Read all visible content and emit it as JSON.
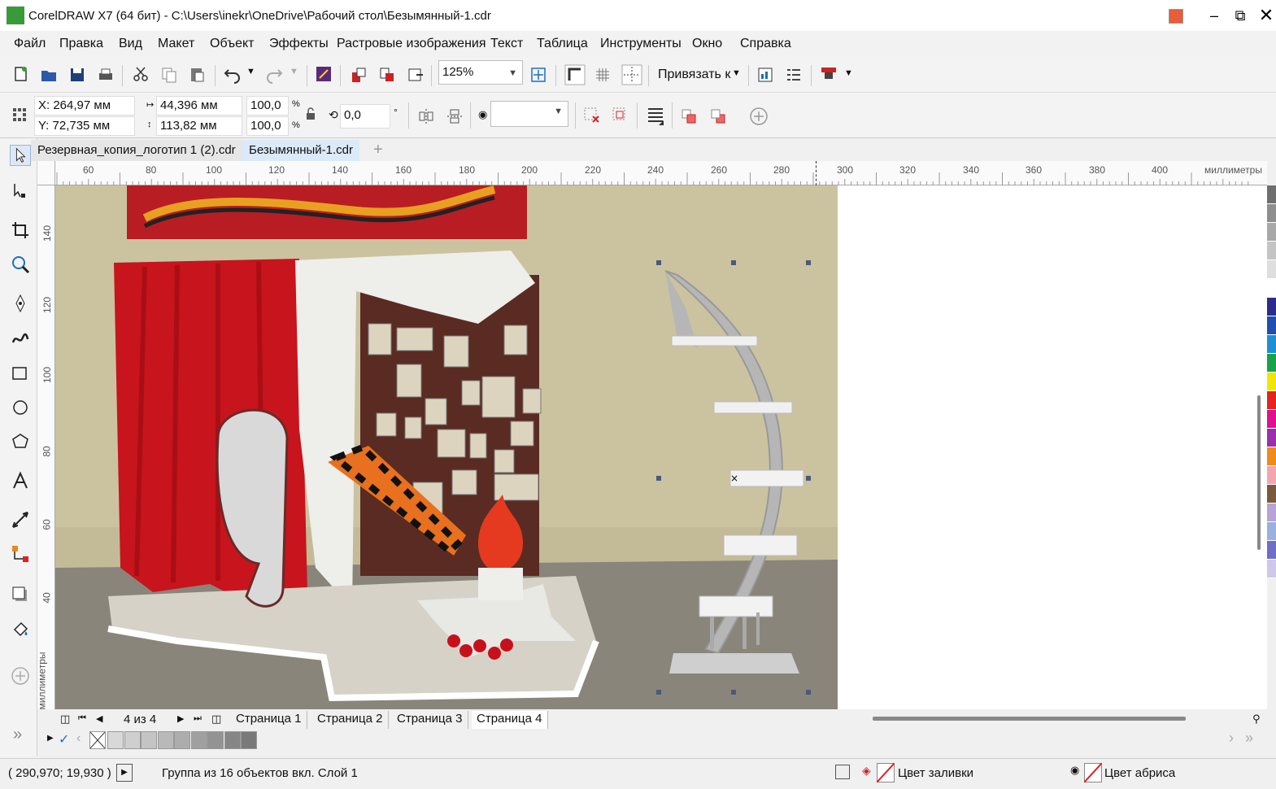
{
  "window": {
    "title": "CorelDRAW X7 (64 бит) - C:\\Users\\inekr\\OneDrive\\Рабочий стол\\Безымянный-1.cdr"
  },
  "menu": [
    "Файл",
    "Правка",
    "Вид",
    "Макет",
    "Объект",
    "Эффекты",
    "Растровые изображения",
    "Текст",
    "Таблица",
    "Инструменты",
    "Окно",
    "Справка"
  ],
  "toolbar": {
    "zoom": "125%",
    "snap_label": "Привязать к"
  },
  "properties": {
    "x": "X: 264,97 мм",
    "y": "Y: 72,735 мм",
    "width": "44,396 мм",
    "height": "113,82 мм",
    "scale_w": "100,0",
    "scale_h": "100,0",
    "percent": "%",
    "angle": "0,0",
    "degree": "°"
  },
  "tabs": [
    "Резервная_копия_логотип 1 (2).cdr",
    "Безымянный-1.cdr"
  ],
  "ruler": {
    "h_ticks": [
      "60",
      "80",
      "100",
      "120",
      "140",
      "160",
      "180",
      "200",
      "220",
      "240",
      "260",
      "280",
      "300",
      "320",
      "340",
      "360",
      "380",
      "400"
    ],
    "h_unit": "миллиметры",
    "v_ticks": [
      "140",
      "120",
      "100",
      "80",
      "60",
      "40"
    ],
    "v_unit": "миллиметры"
  },
  "pages": {
    "counter": "4 из 4",
    "tabs": [
      "Страница 1",
      "Страница 2",
      "Страница 3",
      "Страница 4"
    ]
  },
  "status": {
    "coords": "( 290,970; 19,930 )",
    "selection": "Группа из 16 объектов вкл. Слой 1",
    "fill": "Цвет заливки",
    "outline": "Цвет абриса"
  },
  "palette": [
    "#6e6e6e",
    "#8e8e8e",
    "#a8a8a8",
    "#c4c4c4",
    "#dedede",
    "#ffffff",
    "#2c2c8c",
    "#1f4fb0",
    "#1e8fd6",
    "#18a34a",
    "#f2e600",
    "#e8231e",
    "#e0118f",
    "#9b2fae",
    "#f08a1b",
    "#f4a6b0",
    "#7a5a3c",
    "#b8a2d6",
    "#9ab0e0",
    "#6e6ec8",
    "#d0c8e8"
  ],
  "swatches": [
    "#d8d8d8",
    "#cfcfcf",
    "#c4c4c4",
    "#b9b9b9",
    "#adadad",
    "#a0a0a0",
    "#939393",
    "#868686",
    "#797979"
  ]
}
